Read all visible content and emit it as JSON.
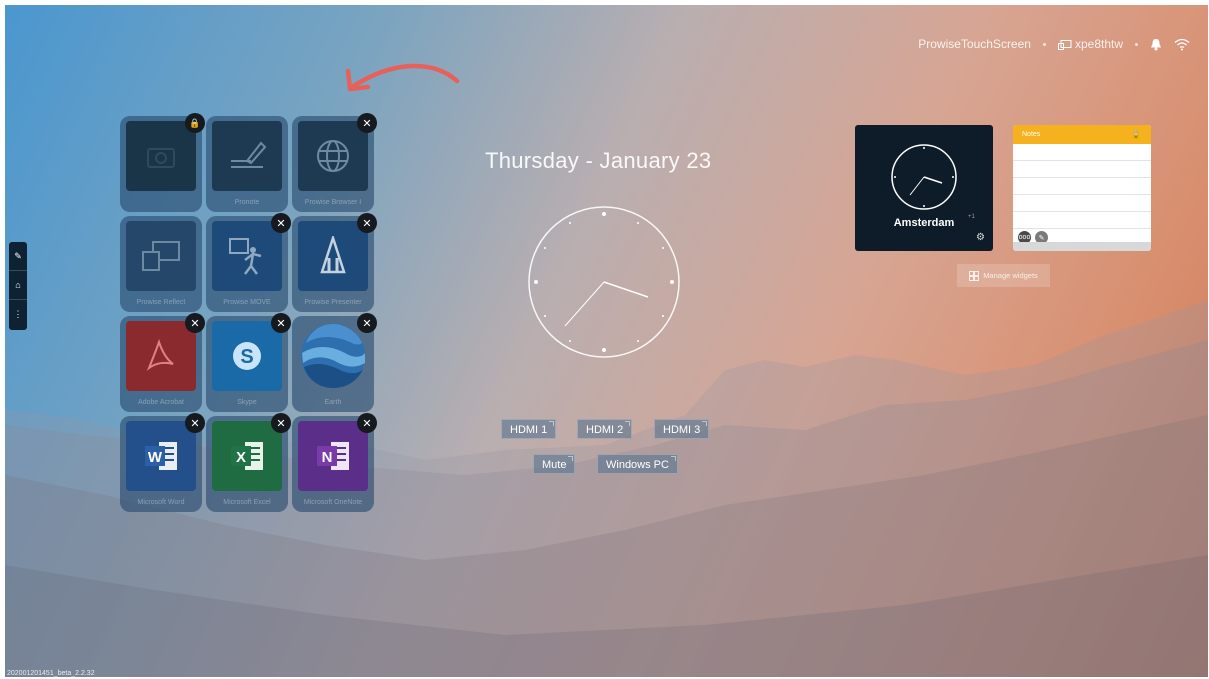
{
  "status_bar": {
    "device_name": "ProwiseTouchScreen",
    "connection_code": "xpe8thtw",
    "bell_icon": "bell-icon",
    "wifi_icon": "wifi-icon"
  },
  "left_toolbar": {
    "items": [
      {
        "icon": "pen-icon",
        "glyph": "✎"
      },
      {
        "icon": "home-icon",
        "glyph": "⌂"
      },
      {
        "icon": "menu-icon",
        "glyph": "⋮"
      }
    ]
  },
  "apps": [
    {
      "label": "",
      "badge": "lock",
      "badge_glyph": "🔒"
    },
    {
      "label": "Pronote",
      "badge": "",
      "badge_glyph": ""
    },
    {
      "label": "Prowise Browser I",
      "badge": "close",
      "badge_glyph": "✕"
    },
    {
      "label": "Prowise Reflect",
      "badge": "",
      "badge_glyph": ""
    },
    {
      "label": "Prowise MOVE",
      "badge": "close",
      "badge_glyph": "✕"
    },
    {
      "label": "Prowise Presenter",
      "badge": "close",
      "badge_glyph": "✕"
    },
    {
      "label": "Adobe Acrobat",
      "badge": "close",
      "badge_glyph": "✕"
    },
    {
      "label": "Skype",
      "badge": "close",
      "badge_glyph": "✕"
    },
    {
      "label": "Earth",
      "badge": "close",
      "badge_glyph": "✕"
    },
    {
      "label": "Microsoft Word",
      "badge": "close",
      "badge_glyph": "✕"
    },
    {
      "label": "Microsoft Excel",
      "badge": "close",
      "badge_glyph": "✕"
    },
    {
      "label": "Microsoft OneNote",
      "badge": "close",
      "badge_glyph": "✕"
    }
  ],
  "center": {
    "date": "Thursday - January 23",
    "inputs": [
      "HDMI 1",
      "HDMI 2",
      "HDMI 3",
      "Mute",
      "Windows PC"
    ]
  },
  "widgets": {
    "clock": {
      "city": "Amsterdam",
      "tz": "+1"
    },
    "notes": {
      "title": "Notes",
      "b1": "ooo"
    },
    "manage_label": "Manage widgets"
  },
  "version": "202001201451_beta_2.2.32",
  "colors": {
    "notes_header": "#f5b21e",
    "widget_dark": "#0d1c28",
    "arrow": "#e8605a"
  }
}
